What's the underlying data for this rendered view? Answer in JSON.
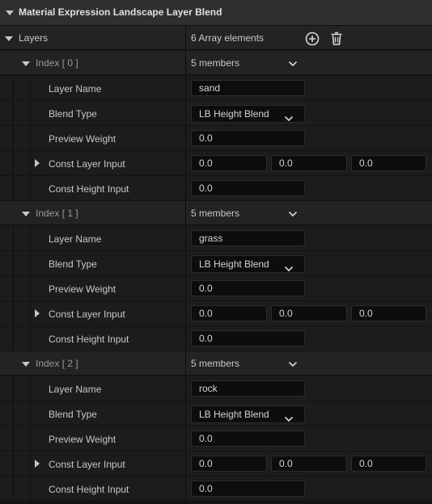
{
  "panel": {
    "title": "Material Expression Landscape Layer Blend",
    "layers": {
      "label": "Layers",
      "count": "6 Array elements",
      "add_icon": "plus-circle-icon",
      "delete_icon": "trash-icon"
    }
  },
  "labels": {
    "layer_name": "Layer Name",
    "blend_type": "Blend Type",
    "preview_weight": "Preview Weight",
    "const_layer_input": "Const Layer Input",
    "const_height_input": "Const Height Input"
  },
  "entries": [
    {
      "index_label": "Index [ 0 ]",
      "members": "5 members",
      "layer_name": "sand",
      "blend_type": "LB Height Blend",
      "preview_weight": "0.0",
      "const_layer_input": [
        "0.0",
        "0.0",
        "0.0"
      ],
      "const_height_input": "0.0"
    },
    {
      "index_label": "Index [ 1 ]",
      "members": "5 members",
      "layer_name": "grass",
      "blend_type": "LB Height Blend",
      "preview_weight": "0.0",
      "const_layer_input": [
        "0.0",
        "0.0",
        "0.0"
      ],
      "const_height_input": "0.0"
    },
    {
      "index_label": "Index [ 2 ]",
      "members": "5 members",
      "layer_name": "rock",
      "blend_type": "LB Height Blend",
      "preview_weight": "0.0",
      "const_layer_input": [
        "0.0",
        "0.0",
        "0.0"
      ],
      "const_height_input": "0.0"
    }
  ],
  "colors": {
    "header_bg": "#2f2f2f",
    "row_bg": "#1c1c1c",
    "input_bg": "#0d0d0d",
    "text": "#c8c8c8"
  }
}
